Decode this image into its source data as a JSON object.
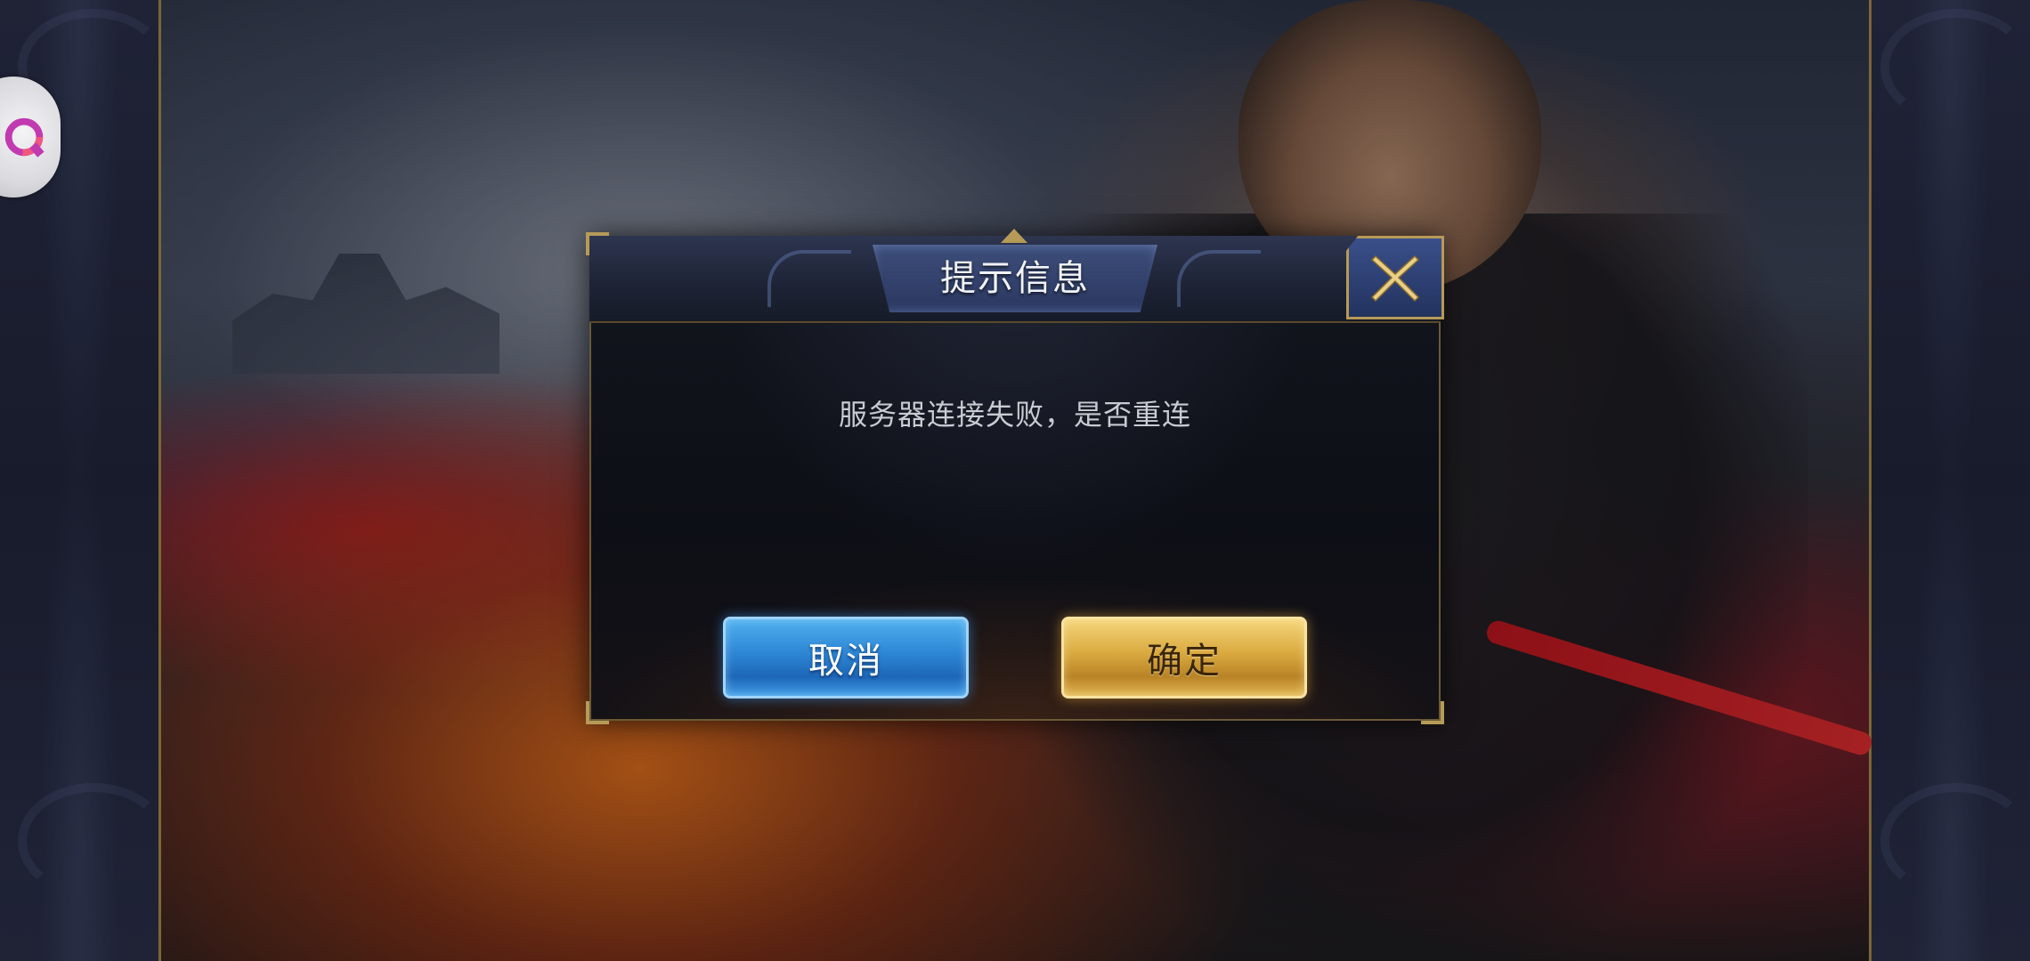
{
  "dialog": {
    "title": "提示信息",
    "message": "服务器连接失败，是否重连",
    "cancel_label": "取消",
    "confirm_label": "确定"
  },
  "icons": {
    "close": "close-x-icon",
    "assistant": "floating-assistant-icon"
  },
  "colors": {
    "frame_gold": "#b69a57",
    "cancel_blue": "#2d86d4",
    "confirm_gold": "#d9a93f",
    "dialog_bg": "#0d0f16"
  }
}
